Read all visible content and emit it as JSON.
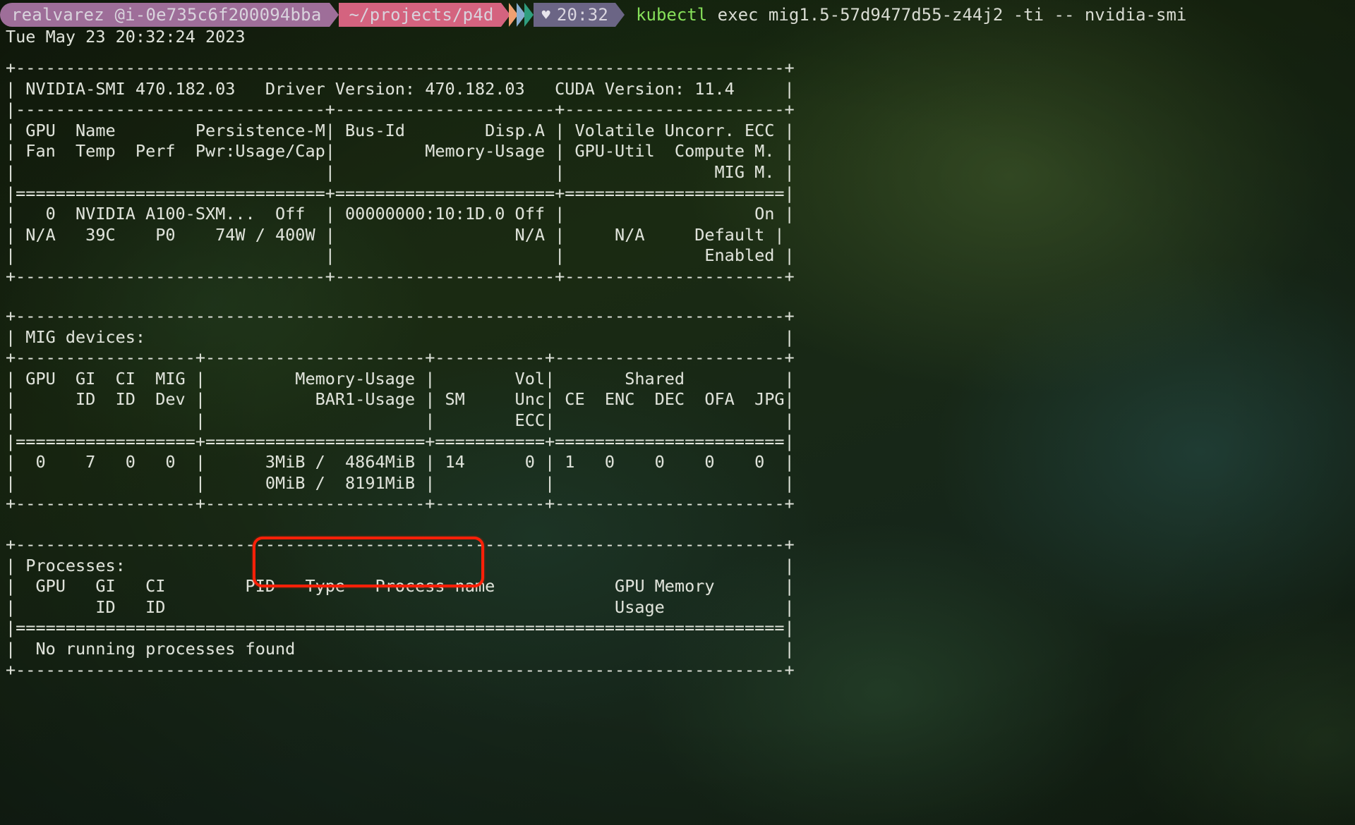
{
  "prompt": {
    "user_host": "realvarez @i-0e735c6f200094bba",
    "path": "~/projects/p4d",
    "heart_icon": "heart-icon",
    "time": "20:32",
    "command_keyword": "kubectl",
    "command_rest": " exec mig1.5-57d9477d55-z44j2 -ti -- nvidia-smi",
    "colors": {
      "user_segment": "#9e6e99",
      "path_segment": "#d4637f",
      "arrow_orange": "#f0a070",
      "arrow_blue": "#86aed0",
      "arrow_teal": "#2f9e7e",
      "time_segment": "#6b6585",
      "keyword": "#86e05a",
      "text": "#d8dbd2"
    }
  },
  "output": {
    "datestamp": "Tue May 23 20:32:24 2023",
    "smi_block": "+-----------------------------------------------------------------------------+\n| NVIDIA-SMI 470.182.03   Driver Version: 470.182.03   CUDA Version: 11.4     |\n|-------------------------------+----------------------+----------------------+\n| GPU  Name        Persistence-M| Bus-Id        Disp.A | Volatile Uncorr. ECC |\n| Fan  Temp  Perf  Pwr:Usage/Cap|         Memory-Usage | GPU-Util  Compute M. |\n|                               |                      |               MIG M. |\n|===============================+======================+======================|\n|   0  NVIDIA A100-SXM...  Off  | 00000000:10:1D.0 Off |                   On |\n| N/A   39C    P0    74W / 400W |                  N/A |     N/A     Default |\n|                               |                      |              Enabled |\n+-------------------------------+----------------------+----------------------+",
    "mig_block": "+-----------------------------------------------------------------------------+\n| MIG devices:                                                                |\n+------------------+----------------------+-----------+-----------------------+\n| GPU  GI  CI  MIG |         Memory-Usage |        Vol|       Shared          |\n|      ID  ID  Dev |           BAR1-Usage | SM     Unc| CE  ENC  DEC  OFA  JPG|\n|                  |                      |        ECC|                       |\n|==================+======================+===========+=======================|\n|  0    7   0   0  |      3MiB /  4864MiB | 14      0 | 1   0    0    0    0  |\n|                  |      0MiB /  8191MiB |           |                       |\n+------------------+----------------------+-----------+-----------------------+",
    "processes_block": "+-----------------------------------------------------------------------------+\n| Processes:                                                                  |\n|  GPU   GI   CI        PID   Type   Process name            GPU Memory       |\n|        ID   ID                                             Usage            |\n|=============================================================================|\n|  No running processes found                                                 |\n+-----------------------------------------------------------------------------+"
  },
  "smi_table": {
    "header_line": "NVIDIA-SMI 470.182.03   Driver Version: 470.182.03   CUDA Version: 11.4",
    "nvidia_smi_version": "470.182.03",
    "driver_version": "470.182.03",
    "cuda_version": "11.4",
    "columns_row1": [
      "GPU",
      "Name",
      "Persistence-M",
      "Bus-Id",
      "Disp.A",
      "Volatile Uncorr. ECC"
    ],
    "columns_row2": [
      "Fan",
      "Temp",
      "Perf",
      "Pwr:Usage/Cap",
      "Memory-Usage",
      "GPU-Util",
      "Compute M."
    ],
    "columns_row3": [
      "MIG M."
    ],
    "rows": [
      {
        "gpu": "0",
        "name": "NVIDIA A100-SXM...",
        "persistence_m": "Off",
        "bus_id": "00000000:10:1D.0",
        "disp_a": "Off",
        "ecc": "On",
        "fan": "N/A",
        "temp": "39C",
        "perf": "P0",
        "pwr_usage_cap": "74W / 400W",
        "memory_usage": "N/A",
        "gpu_util": "N/A",
        "compute_m": "Default",
        "mig_m": "Enabled"
      }
    ]
  },
  "mig_table": {
    "title": "MIG devices:",
    "columns_row1": [
      "GPU",
      "GI",
      "CI",
      "MIG",
      "Memory-Usage",
      "Vol",
      "Shared"
    ],
    "columns_row2": [
      "ID",
      "ID",
      "Dev",
      "BAR1-Usage",
      "SM",
      "Unc",
      "CE",
      "ENC",
      "DEC",
      "OFA",
      "JPG"
    ],
    "columns_row3": [
      "ECC"
    ],
    "rows": [
      {
        "gpu": "0",
        "gi_id": "7",
        "ci_id": "0",
        "mig_dev": "0",
        "memory_usage": "3MiB /  4864MiB",
        "bar1_usage": "0MiB /  8191MiB",
        "sm": "14",
        "vol_unc_ecc": "0",
        "ce": "1",
        "enc": "0",
        "dec": "0",
        "ofa": "0",
        "jpg": "0"
      }
    ]
  },
  "processes_table": {
    "title": "Processes:",
    "columns_row1": [
      "GPU",
      "GI",
      "CI",
      "PID",
      "Type",
      "Process name",
      "GPU Memory"
    ],
    "columns_row2": [
      "ID",
      "ID",
      "Usage"
    ],
    "empty_message": "No running processes found"
  },
  "annotation": {
    "label": "memory-usage-highlight",
    "color": "#ff2008",
    "highlighted_values": [
      "3MiB /  4864MiB",
      "0MiB /  8191MiB"
    ]
  }
}
